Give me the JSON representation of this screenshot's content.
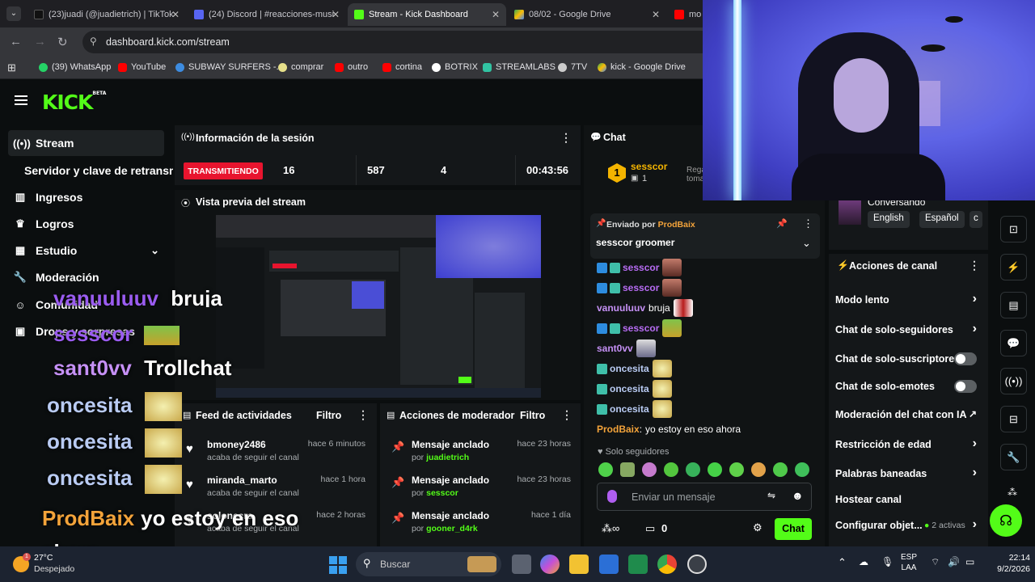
{
  "browser": {
    "tabs": [
      {
        "title": "(23)juadi (@juadietrich) | TikTok",
        "active": false
      },
      {
        "title": "(24) Discord | #reacciones-musi",
        "active": false
      },
      {
        "title": "Stream - Kick Dashboard",
        "active": true
      },
      {
        "title": "08/02 - Google Drive",
        "active": false
      },
      {
        "title": "mo",
        "active": false
      }
    ],
    "url": "dashboard.kick.com/stream",
    "bookmarks": [
      "(39) WhatsApp",
      "YouTube",
      "SUBWAY SURFERS -...",
      "comprar",
      "outro",
      "cortina",
      "BOTRIX",
      "STREAMLABS",
      "7TV",
      "kick - Google Drive"
    ]
  },
  "app": {
    "logo": "KICK",
    "logo_tag": "BETA",
    "sidebar": {
      "items": [
        {
          "label": "Stream",
          "icon": "broadcast-icon",
          "active": true
        },
        {
          "label": "Servidor y clave de retransm",
          "icon": "",
          "active": false
        },
        {
          "label": "Ingresos",
          "icon": "bank-icon",
          "active": false
        },
        {
          "label": "Logros",
          "icon": "trophy-icon",
          "active": false
        },
        {
          "label": "Estudio",
          "icon": "studio-icon",
          "active": false
        },
        {
          "label": "Moderación",
          "icon": "wrench-icon",
          "active": false
        },
        {
          "label": "Comunidad",
          "icon": "community-icon",
          "active": false
        },
        {
          "label": "Drops y sorpresas",
          "icon": "drops-icon",
          "active": false
        }
      ]
    },
    "session": {
      "title": "Información de la sesión",
      "status": "TRANSMITIENDO",
      "viewers": "16",
      "followers": "587",
      "subs": "4",
      "duration": "00:43:56"
    },
    "preview": {
      "title": "Vista previa del stream"
    },
    "feed": {
      "title": "Feed de actividades",
      "filter": "Filtro",
      "rows": [
        {
          "name": "bmoney2486",
          "text": "acaba de seguir el canal",
          "time": "hace 6 minutos"
        },
        {
          "name": "miranda_marto",
          "text": "acaba de seguir el canal",
          "time": "hace 1 hora"
        },
        {
          "name": "solonecra",
          "text": "acaba de seguir el canal",
          "time": "hace 2 horas"
        }
      ]
    },
    "mod_actions": {
      "title": "Acciones de moderador",
      "filter": "Filtro",
      "rows": [
        {
          "title": "Mensaje anclado",
          "prefix": "por",
          "user": "juadietrich",
          "time": "hace 23 horas"
        },
        {
          "title": "Mensaje anclado",
          "prefix": "por",
          "user": "sesscor",
          "time": "hace 23 horas"
        },
        {
          "title": "Mensaje anclado",
          "prefix": "por",
          "user": "gooner_d4rk",
          "time": "hace 1 día"
        }
      ]
    },
    "chat": {
      "title": "Chat",
      "top_gifter": {
        "rank": "1",
        "name": "sesscor",
        "count": "1"
      },
      "gift_hint": "Rega toma",
      "pinned": {
        "label": "Enviado por",
        "user": "ProdBaix",
        "message": "sesscor groomer"
      },
      "messages": [
        {
          "user": "sesscor",
          "color": "#b76cf3",
          "text": "",
          "emote": true
        },
        {
          "user": "sesscor",
          "color": "#b76cf3",
          "text": "",
          "emote": true
        },
        {
          "user": "vanuuluuv",
          "color": "#c590f5",
          "text": "bruja",
          "emote": true
        },
        {
          "user": "sesscor",
          "color": "#b76cf3",
          "text": "",
          "emote": true
        },
        {
          "user": "sant0vv",
          "color": "#c590f5",
          "text": "",
          "emote": true
        },
        {
          "user": "oncesita",
          "color": "#b9cbf3",
          "text": "",
          "emote": true
        },
        {
          "user": "oncesita",
          "color": "#b9cbf3",
          "text": "",
          "emote": true
        },
        {
          "user": "oncesita",
          "color": "#b9cbf3",
          "text": "",
          "emote": true
        },
        {
          "user": "ProdBaix",
          "color": "#f3a33a",
          "text": "yo estoy en eso ahora",
          "emote": false
        }
      ],
      "followers_only": "Solo seguidores",
      "input_placeholder": "Enviar un mensaje",
      "points": "0",
      "send_label": "Chat"
    },
    "channel_actions": {
      "title": "Acciones de canal",
      "status_label": "Conversando",
      "languages": [
        "English",
        "Español",
        "c"
      ],
      "items": [
        {
          "label": "Modo lento",
          "control": "chevron"
        },
        {
          "label": "Chat de solo-seguidores",
          "control": "chevron"
        },
        {
          "label": "Chat de solo-suscriptores",
          "control": "toggle"
        },
        {
          "label": "Chat de solo-emotes",
          "control": "toggle"
        },
        {
          "label": "Moderación del chat con IA",
          "control": "external"
        },
        {
          "label": "Restricción de edad",
          "control": "chevron"
        },
        {
          "label": "Palabras baneadas",
          "control": "chevron"
        },
        {
          "label": "Hostear canal",
          "control": "none"
        },
        {
          "label": "Configurar objet...",
          "control": "chevron"
        }
      ],
      "objectives_active": "2 activas"
    }
  },
  "overlay_chat": [
    {
      "user": "vanuuluuv",
      "text": "bruja",
      "color": "#9a5cf0"
    },
    {
      "user": "sesscor",
      "text": "",
      "color": "#9a5cf0"
    },
    {
      "user": "sant0vv",
      "text": "Trollchat",
      "color": "#c590f5"
    },
    {
      "user": "oncesita",
      "text": "",
      "color": "#b9cbf3"
    },
    {
      "user": "oncesita",
      "text": "",
      "color": "#b9cbf3"
    },
    {
      "user": "oncesita",
      "text": "",
      "color": "#b9cbf3"
    },
    {
      "user": "ProdBaix",
      "text": "yo estoy en eso ahora",
      "color": "#f3a33a"
    }
  ],
  "taskbar": {
    "weather_temp": "27°C",
    "weather_desc": "Despejado",
    "weather_badge": "1",
    "search_label": "Buscar",
    "lang": "ESP",
    "lang2": "LAA",
    "time": "22:14",
    "date": "9/2/2026"
  },
  "colors": {
    "kick_green": "#53fc18",
    "live_red": "#e8142e",
    "panel": "#141719",
    "bg": "#0b0e0f"
  }
}
